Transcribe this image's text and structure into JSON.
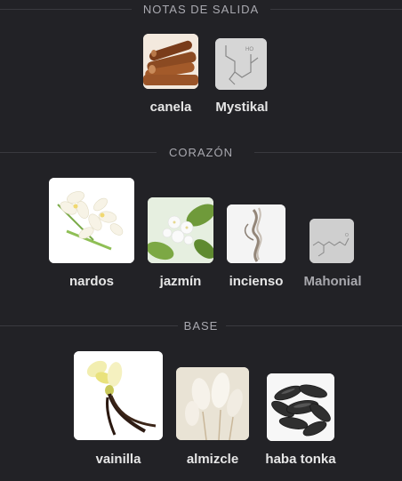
{
  "sections": {
    "top": {
      "title": "NOTAS DE SALIDA"
    },
    "heart": {
      "title": "CORAZÓN"
    },
    "base": {
      "title": "BASE"
    }
  },
  "notes": {
    "canela": {
      "label": "canela",
      "icon": "cinnamon-image"
    },
    "mystikal": {
      "label": "Mystikal",
      "icon": "molecule-structure-image"
    },
    "nardos": {
      "label": "nardos",
      "icon": "tuberose-image"
    },
    "jazmin": {
      "label": "jazmín",
      "icon": "jasmine-image"
    },
    "incienso": {
      "label": "incienso",
      "icon": "incense-smoke-image"
    },
    "mahonial": {
      "label": "Mahonial",
      "icon": "molecule-structure-image"
    },
    "vainilla": {
      "label": "vainilla",
      "icon": "vanilla-image"
    },
    "almizcle": {
      "label": "almizcle",
      "icon": "musk-image"
    },
    "haba_tonka": {
      "label": "haba tonka",
      "icon": "tonka-bean-image"
    }
  },
  "colors": {
    "background": "#222226",
    "label": "#e6e6e6",
    "header": "#a9a9b0",
    "dim_label": "#a8a8ad"
  }
}
